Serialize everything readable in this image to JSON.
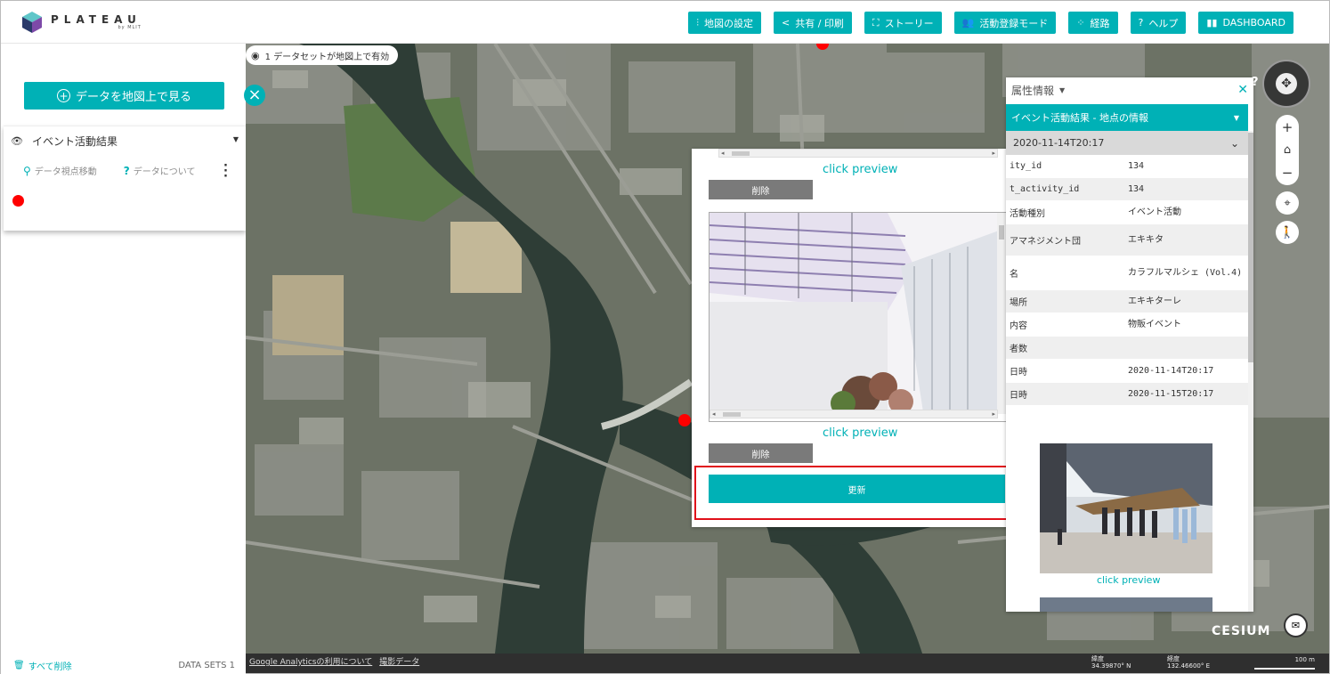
{
  "header": {
    "logo_text": "PLATEAU",
    "logo_sub": "by MLIT",
    "nav": [
      {
        "icon": "settings-sliders-icon",
        "glyph": "⫶",
        "label": "地図の設定"
      },
      {
        "icon": "share-icon",
        "glyph": "<",
        "label": "共有 / 印刷"
      },
      {
        "icon": "story-icon",
        "glyph": "⛶",
        "label": "ストーリー"
      },
      {
        "icon": "users-icon",
        "glyph": "👥",
        "label": "活動登録モード"
      },
      {
        "icon": "route-icon",
        "glyph": "⁘",
        "label": "経路"
      },
      {
        "icon": "help-icon",
        "glyph": "?",
        "label": "ヘルプ"
      },
      {
        "icon": "book-icon",
        "glyph": "▮▮",
        "label": "DASHBOARD"
      }
    ]
  },
  "left_panel": {
    "view_button": "データを地図上で見る",
    "dataset": {
      "title": "イベント活動結果",
      "action_move": "データ視点移動",
      "action_about": "データについて"
    },
    "footer": {
      "delete_all": "すべて削除",
      "count": "DATA SETS 1"
    }
  },
  "map": {
    "dataset_pill": "1 データセットが地図上で有効",
    "footer_links": [
      "Google Analyticsの利用について",
      "撮影データ"
    ],
    "lat_label": "緯度",
    "lat_value": "34.39870° N",
    "lon_label": "経度",
    "lon_value": "132.46600° E",
    "scale": "100 m",
    "cesium": "CESIUM"
  },
  "popup": {
    "click_preview_1": "click preview",
    "delete_1": "削除",
    "click_preview_2": "click preview",
    "delete_2": "削除",
    "update": "更新"
  },
  "attributes": {
    "title": "属性情報",
    "section": "イベント活動結果 - 地点の情報",
    "timestamp": "2020-11-14T20:17",
    "rows": [
      {
        "k": "ity_id",
        "v": "134"
      },
      {
        "k": "t_activity_id",
        "v": "134"
      },
      {
        "k": "活動種別",
        "v": "イベント活動"
      },
      {
        "k": "アマネジメント団",
        "v": "エキキタ"
      },
      {
        "k": "名",
        "v": "カラフルマルシェ (Vol.4)"
      },
      {
        "k": "場所",
        "v": "エキキターレ"
      },
      {
        "k": "内容",
        "v": "物販イベント"
      },
      {
        "k": "者数",
        "v": ""
      },
      {
        "k": "日時",
        "v": "2020-11-14T20:17"
      },
      {
        "k": "日時",
        "v": "2020-11-15T20:17"
      }
    ],
    "click_preview": "click preview"
  },
  "colors": {
    "accent": "#00b1b6",
    "highlight": "#e0101a",
    "marker": "#ff0000"
  }
}
